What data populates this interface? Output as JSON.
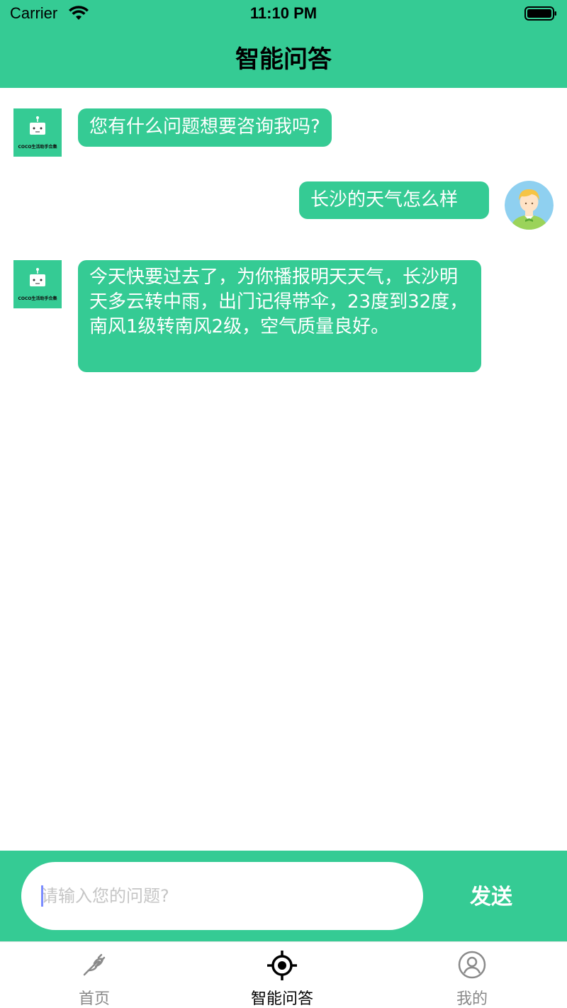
{
  "status_bar": {
    "carrier": "Carrier",
    "time": "11:10 PM"
  },
  "header": {
    "title": "智能问答"
  },
  "messages": [
    {
      "from": "bot",
      "avatar_label": "COCO生活助手合集",
      "text": "您有什么问题想要咨询我吗?"
    },
    {
      "from": "user",
      "text": "长沙的天气怎么样"
    },
    {
      "from": "bot",
      "avatar_label": "COCO生活助手合集",
      "text": "今天快要过去了，为你播报明天天气，长沙明天多云转中雨，出门记得带伞，23度到32度，南风1级转南风2级，空气质量良好。"
    }
  ],
  "input": {
    "placeholder": "请输入您的问题?",
    "value": "",
    "send_label": "发送"
  },
  "tabbar": {
    "tabs": [
      {
        "label": "首页",
        "icon": "plug-icon"
      },
      {
        "label": "智能问答",
        "icon": "target-icon",
        "active": true
      },
      {
        "label": "我的",
        "icon": "user-circle-icon"
      }
    ]
  },
  "colors": {
    "accent": "#35cb94",
    "bubble_text": "#ffffff",
    "tab_active": "#000000",
    "tab_inactive": "#888888"
  }
}
